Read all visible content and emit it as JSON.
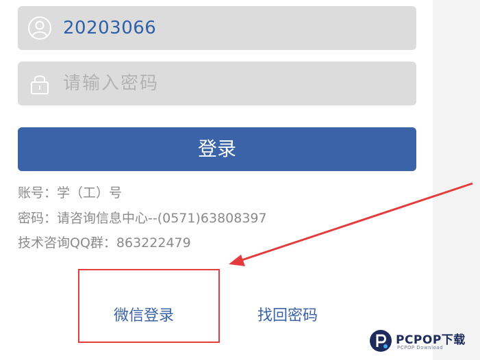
{
  "login_form": {
    "username_value": "20203066",
    "password_placeholder": "请输入密码",
    "login_label": "登录"
  },
  "info": {
    "account": "账号：学（工）号",
    "password_help": "密码：请咨询信息中心--(0571)63808397",
    "qq_group": "技术咨询QQ群：863222479"
  },
  "links": {
    "wechat_login": "微信登录",
    "find_password": "找回密码"
  },
  "watermark": {
    "title": "PCPOP下载",
    "subtitle": "PCPOP Download"
  },
  "icons": {
    "username": "user-icon",
    "password": "lock-icon"
  },
  "colors": {
    "primary": "#3a63a8",
    "field_bg": "#dcdcdc",
    "annotation_red": "#e43c3c",
    "value_text": "#2f5fa8"
  }
}
